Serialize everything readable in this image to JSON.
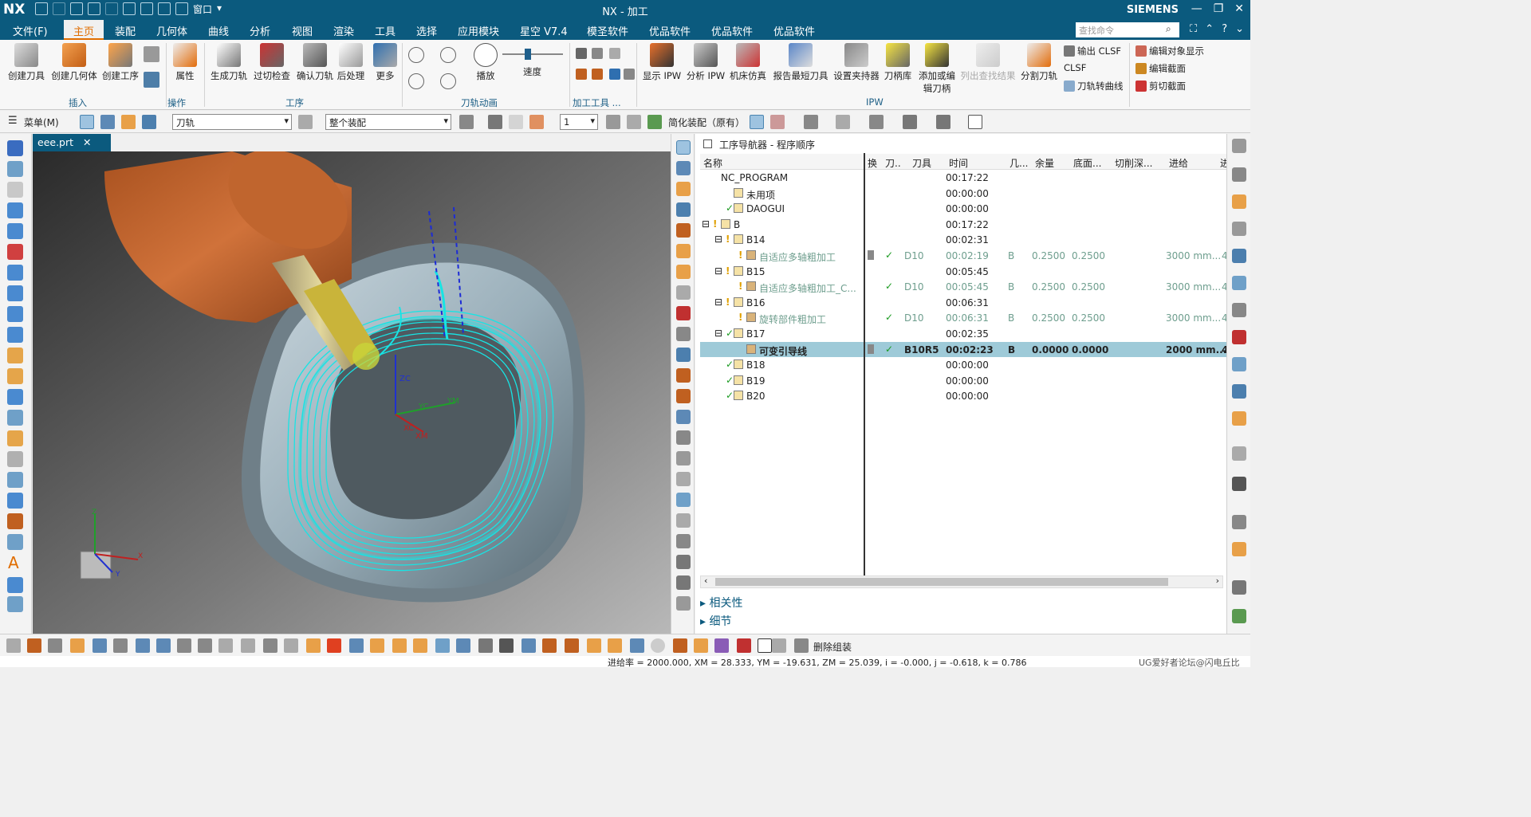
{
  "app": {
    "logo": "NX",
    "window_title": "NX - 加工",
    "brand": "SIEMENS",
    "quick_access_window": "窗口",
    "window_controls": [
      "—",
      "❐",
      "✕"
    ]
  },
  "menu": {
    "items": [
      "文件(F)",
      "主页",
      "装配",
      "几何体",
      "曲线",
      "分析",
      "视图",
      "渲染",
      "工具",
      "选择",
      "应用模块",
      "星空 V7.4",
      "模圣软件",
      "优品软件",
      "优品软件",
      "优品软件"
    ],
    "active_index": 1,
    "search_placeholder": "查找命令"
  },
  "ribbon": {
    "insert": [
      "创建刀具",
      "创建几何体",
      "创建工序"
    ],
    "properties": "属性",
    "operation": [
      "生成刀轨",
      "过切检查",
      "确认刀轨",
      "后处理",
      "更多"
    ],
    "animation": [
      "播放",
      "速度"
    ],
    "ipw": [
      "显示 IPW",
      "分析 IPW",
      "机床仿真",
      "报告最短刀具",
      "设置夹持器",
      "刀柄库",
      "添加或编",
      "辑刀柄",
      "列出查找结果",
      "分割刀轨"
    ],
    "small": [
      "输出 CLSF",
      "CLSF",
      "刀轨转曲线",
      "编辑对象显示",
      "编辑截面",
      "剪切截面"
    ],
    "groups": [
      "插入",
      "操作",
      "工序",
      "刀轨动画",
      "加工工具 ...",
      "IPW"
    ]
  },
  "toolbar2": {
    "menu_label": "菜单(M)",
    "filter_type": "刀轨",
    "assembly_scope": "整个装配",
    "layer": "1",
    "simplified": "简化装配（原有）"
  },
  "document_tab": "eee.prt",
  "viewport_axes": [
    "YC",
    "YM",
    "XC",
    "XM",
    "ZC",
    "X",
    "Y",
    "Z"
  ],
  "navigator": {
    "title": "工序导航器 - 程序顺序",
    "columns": [
      "名称",
      "换",
      "刀..",
      "刀具",
      "时间",
      "几...",
      "余量",
      "底面...",
      "切削深...",
      "进给",
      "进"
    ],
    "rows": [
      {
        "name": "NC_PROGRAM",
        "tool": "",
        "time": "00:17:22",
        "geom": "",
        "stock": "",
        "floor": "",
        "feed": "",
        "more": ""
      },
      {
        "name": "未用项",
        "tool": "",
        "time": "00:00:00",
        "geom": "",
        "stock": "",
        "floor": "",
        "feed": "",
        "more": ""
      },
      {
        "name": "DAOGUI",
        "tool": "",
        "time": "00:00:00",
        "geom": "",
        "stock": "",
        "floor": "",
        "feed": "",
        "more": ""
      },
      {
        "name": "B",
        "tool": "",
        "time": "00:17:22",
        "geom": "",
        "stock": "",
        "floor": "",
        "feed": "",
        "more": ""
      },
      {
        "name": "B14",
        "tool": "",
        "time": "00:02:31",
        "geom": "",
        "stock": "",
        "floor": "",
        "feed": "",
        "more": ""
      },
      {
        "name": "自适应多轴粗加工",
        "tool": "D10",
        "time": "00:02:19",
        "geom": "B",
        "stock": "0.2500",
        "floor": "0.2500",
        "feed": "3000 mm...",
        "more": "4"
      },
      {
        "name": "B15",
        "tool": "",
        "time": "00:05:45",
        "geom": "",
        "stock": "",
        "floor": "",
        "feed": "",
        "more": ""
      },
      {
        "name": "自适应多轴粗加工_C...",
        "tool": "D10",
        "time": "00:05:45",
        "geom": "B",
        "stock": "0.2500",
        "floor": "0.2500",
        "feed": "3000 mm...",
        "more": "4"
      },
      {
        "name": "B16",
        "tool": "",
        "time": "00:06:31",
        "geom": "",
        "stock": "",
        "floor": "",
        "feed": "",
        "more": ""
      },
      {
        "name": "旋转部件粗加工",
        "tool": "D10",
        "time": "00:06:31",
        "geom": "B",
        "stock": "0.2500",
        "floor": "0.2500",
        "feed": "3000 mm...",
        "more": "4"
      },
      {
        "name": "B17",
        "tool": "",
        "time": "00:02:35",
        "geom": "",
        "stock": "",
        "floor": "",
        "feed": "",
        "more": ""
      },
      {
        "name": "可变引导线",
        "tool": "B10R5",
        "time": "00:02:23",
        "geom": "B",
        "stock": "0.0000",
        "floor": "0.0000",
        "feed": "2000 mm...",
        "more": "4"
      },
      {
        "name": "B18",
        "tool": "",
        "time": "00:00:00",
        "geom": "",
        "stock": "",
        "floor": "",
        "feed": "",
        "more": ""
      },
      {
        "name": "B19",
        "tool": "",
        "time": "00:00:00",
        "geom": "",
        "stock": "",
        "floor": "",
        "feed": "",
        "more": ""
      },
      {
        "name": "B20",
        "tool": "",
        "time": "00:00:00",
        "geom": "",
        "stock": "",
        "floor": "",
        "feed": "",
        "more": ""
      }
    ],
    "panels": [
      "相关性",
      "细节"
    ]
  },
  "bottom": {
    "delete_assembly": "删除组装"
  },
  "status": {
    "text": "进给率 = 2000.000, XM = 28.333, YM = -19.631, ZM = 25.039, i = -0.000, j = -0.618, k = 0.786",
    "watermark": "UG爱好者论坛@闪电丘比"
  },
  "colors": {
    "accent": "#0b5a7e",
    "toolpath": "#17e4e4",
    "tool_holder": "#b85c26",
    "selection": "#9ecad8"
  }
}
